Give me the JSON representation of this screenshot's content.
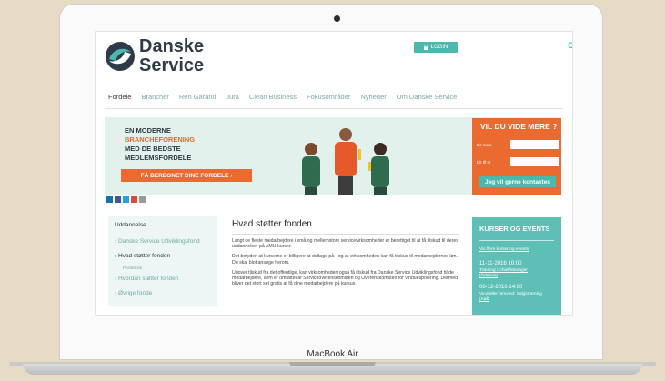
{
  "device": {
    "label": "MacBook Air"
  },
  "header": {
    "logo_line1": "Danske",
    "logo_line2": "Service",
    "login_label": "LOGIN"
  },
  "nav": {
    "items": [
      "Fordele",
      "Brancher",
      "Ren Garanti",
      "Jura",
      "Clean Business",
      "Fokusområder",
      "Nyheder",
      "Om Danske Service"
    ]
  },
  "banner": {
    "line1": "EN MODERNE",
    "line2": "BRANCHEFORENING",
    "line3": "MED DE BEDSTE",
    "line4": "MEDLEMSFORDELE",
    "cta_label": "FÅ BEREGNET DINE FORDELE  ›"
  },
  "contact": {
    "title": "VIL DU VIDE MERE ?",
    "name_label": "Dit navn",
    "phone_label": "Dit tlf nr",
    "button_label": "Jeg vil gerne kontaktes"
  },
  "sidebar": {
    "title": "Uddannelse",
    "items": [
      "›  Danske Service Udviklingsfond",
      "›  Hvad støtter fonden",
      "›  Hvordan støtter fonden",
      "›  Øvrige fonde"
    ],
    "sub_item": "Positivliste"
  },
  "article": {
    "title": "Hvad støtter fonden",
    "p1": "Langt de fleste medarbejdere i små og mellemstore servicevirksomheder er berettiget til at få tilskud til deres uddannelser på AMU-kurser.",
    "p2": "Det betyder, at kurserne er billigere at deltage på - og at virksomheden kan få tilskud til medarbejdernes løn. Du skal blot ansøge herom.",
    "p3": "Udover tilskud fra det offentlige, kan virksomheden også få tilskud fra Danske Service Udviklingsfond til de medarbejdere, som er omfattet af Serviceoverenskomsten og Overenskomsten for vinduespolering. Dermed bliver det stort set gratis at få dine medarbejdere på kursus."
  },
  "events": {
    "title": "KURSER OG EVENTS",
    "link_all": "Vis flere kurser og events",
    "e1_date": "11-11-2016 10:00",
    "e1_title": "Træning i Chief/Manager",
    "e1_place": "(Odense)",
    "e2_date": "08-12-2016 14:00",
    "e2_title": "Vind eller forsvind: Salgstræning",
    "e2_place": "(Aalb"
  },
  "colors": {
    "brand_teal": "#4bb8ae",
    "brand_orange": "#ea6a2f",
    "brand_navy": "#2f3b48"
  }
}
